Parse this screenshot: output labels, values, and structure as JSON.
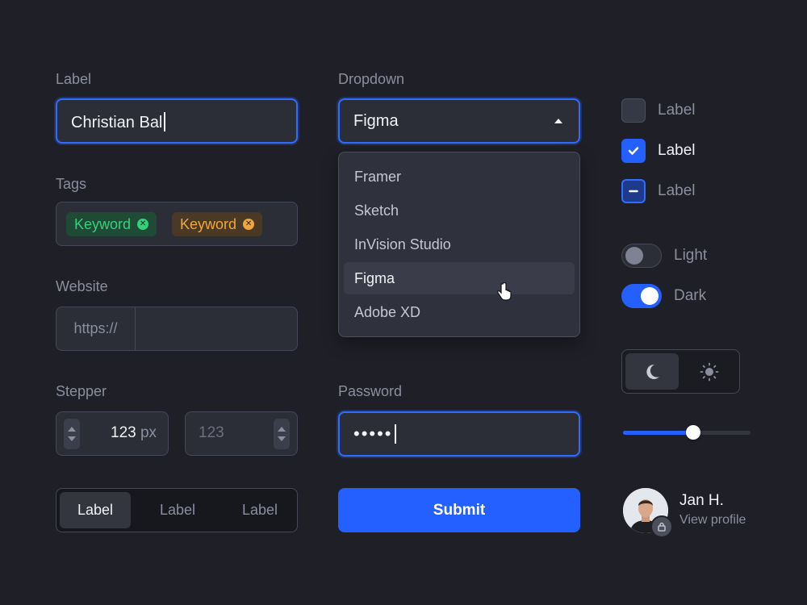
{
  "text_field": {
    "label": "Label",
    "value": "Christian Bal"
  },
  "tags": {
    "label": "Tags",
    "items": [
      {
        "text": "Keyword",
        "color": "#34d17a"
      },
      {
        "text": "Keyword",
        "color": "#f0a63c"
      }
    ]
  },
  "website": {
    "label": "Website",
    "prefix": "https://",
    "value": ""
  },
  "stepper": {
    "label": "Stepper",
    "first_value": "123",
    "first_unit": "px",
    "second_placeholder": "123"
  },
  "segmented": {
    "items": [
      "Label",
      "Label",
      "Label"
    ],
    "selected_index": 0
  },
  "dropdown": {
    "label": "Dropdown",
    "selected": "Figma",
    "options": [
      "Framer",
      "Sketch",
      "InVision Studio",
      "Figma",
      "Adobe XD"
    ],
    "hovered_index": 3
  },
  "password": {
    "label": "Password",
    "masked_value": "•••••"
  },
  "submit": {
    "label": "Submit",
    "color": "#2360ff"
  },
  "checkboxes": [
    {
      "label": "Label",
      "state": "unchecked"
    },
    {
      "label": "Label",
      "state": "checked"
    },
    {
      "label": "Label",
      "state": "indeterminate"
    }
  ],
  "toggles": [
    {
      "label": "Light",
      "on": false
    },
    {
      "label": "Dark",
      "on": true
    }
  ],
  "theme_switch": {
    "options": [
      "moon-icon",
      "sun-icon"
    ],
    "selected": "moon-icon"
  },
  "slider": {
    "value_fraction": 0.5
  },
  "profile": {
    "name": "Jan H.",
    "link": "View profile"
  },
  "colors": {
    "background": "#1f2027",
    "accent": "#2360ff",
    "text": "#f1f2f6",
    "muted": "#8a8e9e"
  }
}
